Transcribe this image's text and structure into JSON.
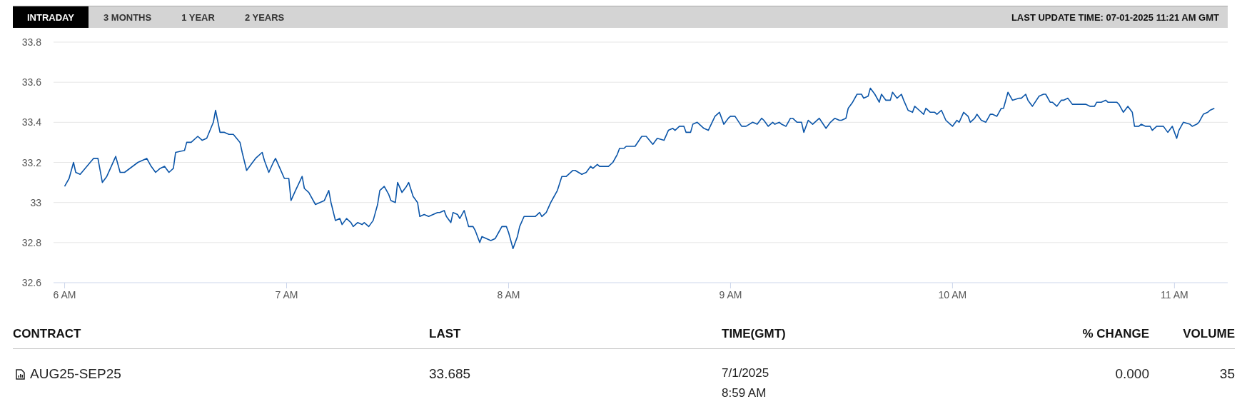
{
  "tabs": [
    {
      "label": "INTRADAY",
      "selected": true
    },
    {
      "label": "3 MONTHS",
      "selected": false
    },
    {
      "label": "1 YEAR",
      "selected": false
    },
    {
      "label": "2 YEARS",
      "selected": false
    }
  ],
  "last_update": "LAST UPDATE TIME: 07-01-2025 11:21 AM GMT",
  "chart_data": {
    "type": "line",
    "xlim": [
      5.95,
      11.24
    ],
    "ylim": [
      32.6,
      33.8
    ],
    "xticks": [
      {
        "value": 6,
        "label": "6 AM"
      },
      {
        "value": 7,
        "label": "7 AM"
      },
      {
        "value": 8,
        "label": "8 AM"
      },
      {
        "value": 9,
        "label": "9 AM"
      },
      {
        "value": 10,
        "label": "10 AM"
      },
      {
        "value": 11,
        "label": "11 AM"
      }
    ],
    "yticks": [
      32.6,
      32.8,
      33,
      33.2,
      33.4,
      33.6,
      33.8
    ],
    "x": [
      6.0,
      6.02,
      6.04,
      6.05,
      6.07,
      6.13,
      6.15,
      6.17,
      6.19,
      6.21,
      6.23,
      6.25,
      6.27,
      6.33,
      6.37,
      6.39,
      6.41,
      6.43,
      6.45,
      6.47,
      6.49,
      6.5,
      6.54,
      6.55,
      6.57,
      6.6,
      6.62,
      6.64,
      6.67,
      6.68,
      6.7,
      6.72,
      6.74,
      6.76,
      6.79,
      6.8,
      6.82,
      6.84,
      6.86,
      6.89,
      6.9,
      6.92,
      6.94,
      6.95,
      6.97,
      6.99,
      7.01,
      7.02,
      7.04,
      7.07,
      7.08,
      7.1,
      7.13,
      7.17,
      7.19,
      7.2,
      7.22,
      7.24,
      7.25,
      7.27,
      7.29,
      7.3,
      7.32,
      7.34,
      7.35,
      7.37,
      7.39,
      7.41,
      7.42,
      7.44,
      7.46,
      7.47,
      7.49,
      7.5,
      7.52,
      7.54,
      7.55,
      7.57,
      7.59,
      7.6,
      7.62,
      7.64,
      7.66,
      7.68,
      7.69,
      7.71,
      7.72,
      7.74,
      7.75,
      7.77,
      7.78,
      7.8,
      7.82,
      7.84,
      7.85,
      7.87,
      7.88,
      7.92,
      7.94,
      7.96,
      7.97,
      7.99,
      8.0,
      8.02,
      8.04,
      8.05,
      8.07,
      8.12,
      8.14,
      8.15,
      8.17,
      8.19,
      8.2,
      8.22,
      8.24,
      8.26,
      8.27,
      8.29,
      8.3,
      8.33,
      8.35,
      8.37,
      8.38,
      8.4,
      8.41,
      8.43,
      8.45,
      8.47,
      8.49,
      8.5,
      8.52,
      8.53,
      8.55,
      8.57,
      8.6,
      8.62,
      8.65,
      8.67,
      8.7,
      8.72,
      8.74,
      8.75,
      8.77,
      8.79,
      8.8,
      8.82,
      8.83,
      8.85,
      8.88,
      8.9,
      8.93,
      8.95,
      8.97,
      8.99,
      9.0,
      9.02,
      9.05,
      9.07,
      9.1,
      9.12,
      9.14,
      9.15,
      9.17,
      9.19,
      9.2,
      9.22,
      9.23,
      9.25,
      9.27,
      9.28,
      9.3,
      9.32,
      9.33,
      9.35,
      9.37,
      9.4,
      9.43,
      9.45,
      9.47,
      9.49,
      9.5,
      9.52,
      9.53,
      9.55,
      9.57,
      9.59,
      9.6,
      9.62,
      9.63,
      9.65,
      9.67,
      9.68,
      9.7,
      9.72,
      9.73,
      9.75,
      9.77,
      9.78,
      9.8,
      9.82,
      9.83,
      9.85,
      9.87,
      9.88,
      9.9,
      9.92,
      9.93,
      9.95,
      9.97,
      9.99,
      10.0,
      10.02,
      10.03,
      10.05,
      10.07,
      10.08,
      10.1,
      10.11,
      10.13,
      10.15,
      10.17,
      10.18,
      10.2,
      10.22,
      10.23,
      10.25,
      10.27,
      10.3,
      10.31,
      10.33,
      10.34,
      10.36,
      10.39,
      10.41,
      10.42,
      10.44,
      10.45,
      10.47,
      10.49,
      10.5,
      10.52,
      10.54,
      10.6,
      10.62,
      10.64,
      10.65,
      10.67,
      10.69,
      10.7,
      10.72,
      10.74,
      10.75,
      10.77,
      10.79,
      10.81,
      10.82,
      10.84,
      10.85,
      10.87,
      10.89,
      10.9,
      10.92,
      10.95,
      10.97,
      10.99,
      11.01,
      11.02,
      11.04,
      11.07,
      11.08,
      11.1,
      11.11,
      11.13,
      11.15,
      11.16,
      11.18
    ],
    "grid": true,
    "series": [
      {
        "color": "#0b55a8",
        "values": [
          33.08,
          33.12,
          33.2,
          33.15,
          33.14,
          33.22,
          33.22,
          33.1,
          33.13,
          33.18,
          33.23,
          33.15,
          33.15,
          33.2,
          33.22,
          33.18,
          33.15,
          33.17,
          33.18,
          33.15,
          33.17,
          33.25,
          33.26,
          33.3,
          33.3,
          33.33,
          33.31,
          33.32,
          33.4,
          33.46,
          33.35,
          33.35,
          33.34,
          33.34,
          33.3,
          33.25,
          33.16,
          33.19,
          33.22,
          33.25,
          33.21,
          33.15,
          33.2,
          33.22,
          33.17,
          33.12,
          33.12,
          33.01,
          33.06,
          33.13,
          33.07,
          33.05,
          32.99,
          33.01,
          33.06,
          33.0,
          32.91,
          32.92,
          32.89,
          32.92,
          32.9,
          32.88,
          32.9,
          32.89,
          32.9,
          32.88,
          32.91,
          32.99,
          33.06,
          33.08,
          33.04,
          33.01,
          33.0,
          33.1,
          33.05,
          33.08,
          33.1,
          33.03,
          33.0,
          32.93,
          32.94,
          32.93,
          32.94,
          32.95,
          32.95,
          32.96,
          32.93,
          32.9,
          32.95,
          32.94,
          32.92,
          32.96,
          32.88,
          32.88,
          32.86,
          32.8,
          32.83,
          32.81,
          32.82,
          32.86,
          32.88,
          32.88,
          32.85,
          32.77,
          32.83,
          32.88,
          32.93,
          32.93,
          32.95,
          32.93,
          32.95,
          33.0,
          33.02,
          33.06,
          33.13,
          33.13,
          33.14,
          33.16,
          33.16,
          33.14,
          33.15,
          33.18,
          33.17,
          33.19,
          33.18,
          33.18,
          33.18,
          33.2,
          33.24,
          33.27,
          33.27,
          33.28,
          33.28,
          33.28,
          33.33,
          33.33,
          33.29,
          33.32,
          33.31,
          33.36,
          33.37,
          33.36,
          33.38,
          33.38,
          33.35,
          33.35,
          33.39,
          33.4,
          33.37,
          33.36,
          33.43,
          33.45,
          33.39,
          33.42,
          33.43,
          33.43,
          33.38,
          33.38,
          33.4,
          33.39,
          33.42,
          33.41,
          33.38,
          33.4,
          33.39,
          33.4,
          33.39,
          33.38,
          33.42,
          33.42,
          33.4,
          33.4,
          33.35,
          33.41,
          33.39,
          33.42,
          33.37,
          33.4,
          33.42,
          33.41,
          33.41,
          33.42,
          33.47,
          33.5,
          33.54,
          33.54,
          33.52,
          33.53,
          33.57,
          33.54,
          33.5,
          33.54,
          33.51,
          33.51,
          33.55,
          33.52,
          33.54,
          33.51,
          33.46,
          33.45,
          33.48,
          33.46,
          33.44,
          33.47,
          33.45,
          33.45,
          33.44,
          33.46,
          33.41,
          33.39,
          33.38,
          33.41,
          33.4,
          33.45,
          33.43,
          33.4,
          33.42,
          33.44,
          33.41,
          33.4,
          33.44,
          33.44,
          33.43,
          33.47,
          33.47,
          33.55,
          33.51,
          33.52,
          33.52,
          33.54,
          33.51,
          33.48,
          33.53,
          33.54,
          33.54,
          33.5,
          33.5,
          33.48,
          33.51,
          33.51,
          33.52,
          33.49,
          33.49,
          33.48,
          33.48,
          33.5,
          33.5,
          33.51,
          33.5,
          33.5,
          33.5,
          33.49,
          33.45,
          33.48,
          33.45,
          33.38,
          33.38,
          33.39,
          33.38,
          33.38,
          33.36,
          33.38,
          33.38,
          33.35,
          33.38,
          33.32,
          33.36,
          33.4,
          33.39,
          33.38,
          33.39,
          33.4,
          33.44,
          33.45,
          33.46,
          33.47
        ]
      }
    ]
  },
  "table": {
    "columns": [
      "CONTRACT",
      "LAST",
      "TIME(GMT)",
      "% CHANGE",
      "VOLUME"
    ],
    "rows": [
      {
        "contract": "AUG25-SEP25",
        "last": "33.685",
        "date": "7/1/2025",
        "time": "8:59 AM",
        "change": "0.000",
        "volume": "35"
      }
    ]
  }
}
